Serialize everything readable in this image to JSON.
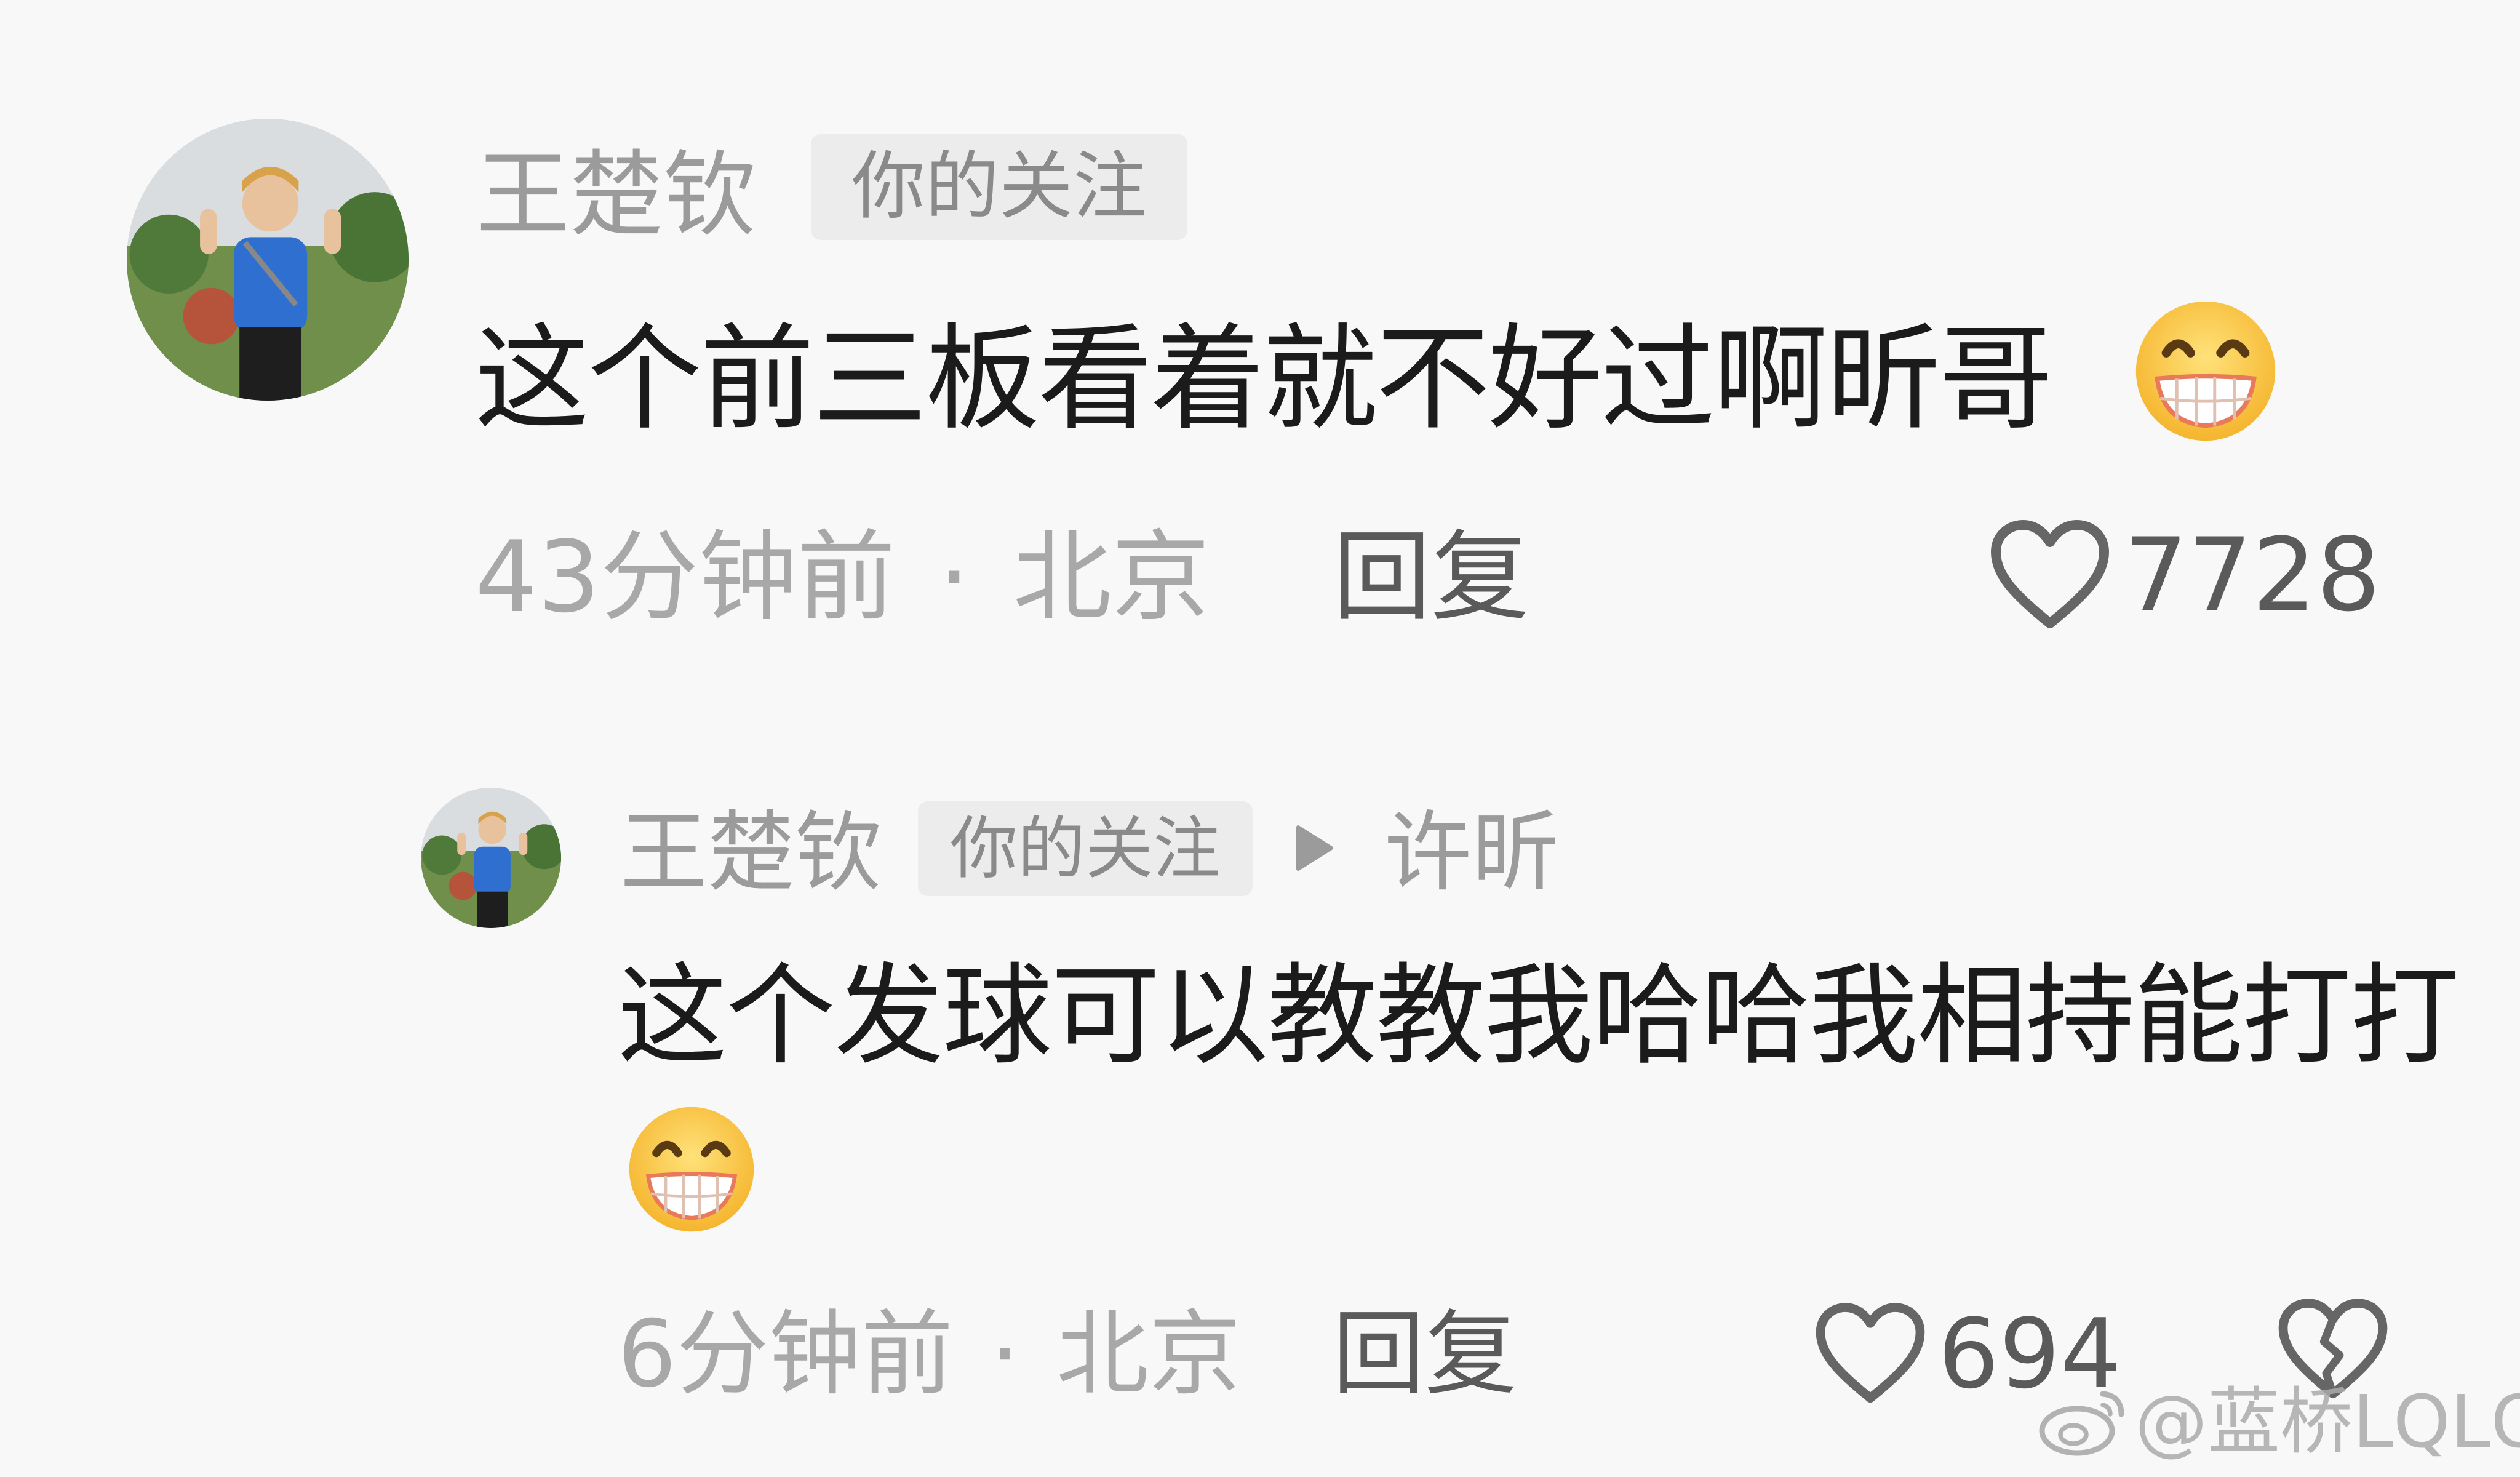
{
  "comments": [
    {
      "username": "王楚钦",
      "tag": "你的关注",
      "text": "这个前三板看着就不好过啊昕哥",
      "emoji": "grinning-teeth-emoji",
      "time": "43分钟前",
      "location": "北京",
      "separator": "·",
      "reply_label": "回复",
      "like_count": "7728"
    }
  ],
  "replies": [
    {
      "username": "王楚钦",
      "tag": "你的关注",
      "reply_to": "许昕",
      "text": "这个发球可以教教我哈哈我相持能打打",
      "emoji": "grinning-teeth-emoji",
      "time": "6分钟前",
      "location": "北京",
      "separator": "·",
      "reply_label": "回复",
      "like_count": "694"
    }
  ],
  "watermark": {
    "text": "@蓝桥LQLQ",
    "icon": "weibo-logo"
  },
  "colors": {
    "background": "#f8f8f8",
    "username": "#9b9b9b",
    "comment_text": "#1b1b1b",
    "meta": "#a8a8a8",
    "action": "#5a5a5a",
    "tag_bg": "#ececec"
  }
}
